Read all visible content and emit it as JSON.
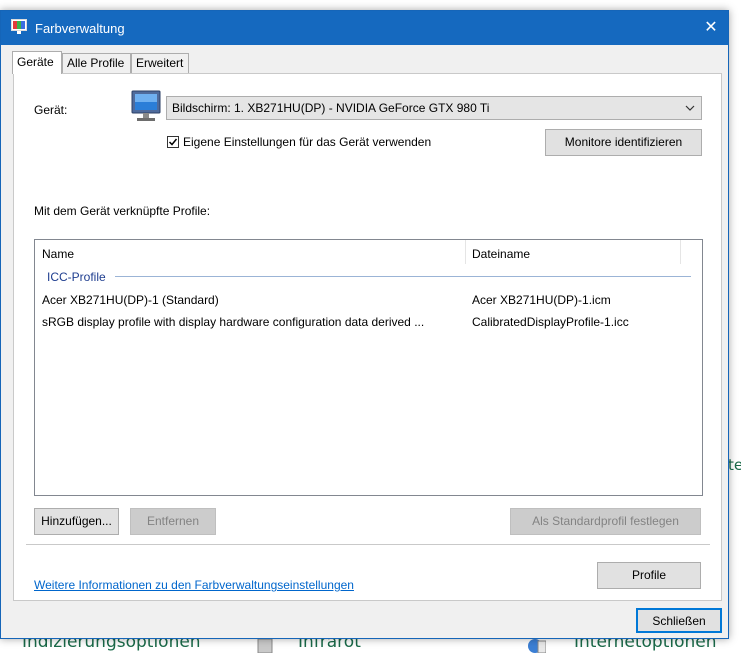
{
  "background": {
    "item_left": "Indizierungsoptionen",
    "item_mid": "Infrarot",
    "item_right": "Internetoptionen",
    "edge_fragment": "te"
  },
  "window": {
    "title": "Farbverwaltung",
    "close_glyph": "✕"
  },
  "tabs": [
    {
      "label": "Geräte",
      "active": true
    },
    {
      "label": "Alle Profile",
      "active": false
    },
    {
      "label": "Erweitert",
      "active": false
    }
  ],
  "device": {
    "label": "Gerät:",
    "selected": "Bildschirm: 1. XB271HU(DP) - NVIDIA GeForce GTX 980 Ti",
    "use_own_settings_label": "Eigene Einstellungen für das Gerät verwenden",
    "use_own_settings_checked": true,
    "identify_button": "Monitore identifizieren"
  },
  "profiles": {
    "section_label": "Mit dem Gerät verknüpfte Profile:",
    "columns": [
      "Name",
      "Dateiname"
    ],
    "group": "ICC-Profile",
    "rows": [
      {
        "name": "Acer XB271HU(DP)-1 (Standard)",
        "file": "Acer XB271HU(DP)-1.icm"
      },
      {
        "name": "sRGB display profile with display hardware configuration data derived ...",
        "file": "CalibratedDisplayProfile-1.icc"
      }
    ],
    "add_button": "Hinzufügen...",
    "remove_button": "Entfernen",
    "set_default_button": "Als Standardprofil festlegen"
  },
  "footer": {
    "link": "Weitere Informationen zu den Farbverwaltungseinstellungen",
    "profiles_button": "Profile",
    "close_button": "Schließen"
  },
  "colors": {
    "titlebar": "#1569bf",
    "link": "#0066cc",
    "group_title": "#1e3d8f"
  }
}
